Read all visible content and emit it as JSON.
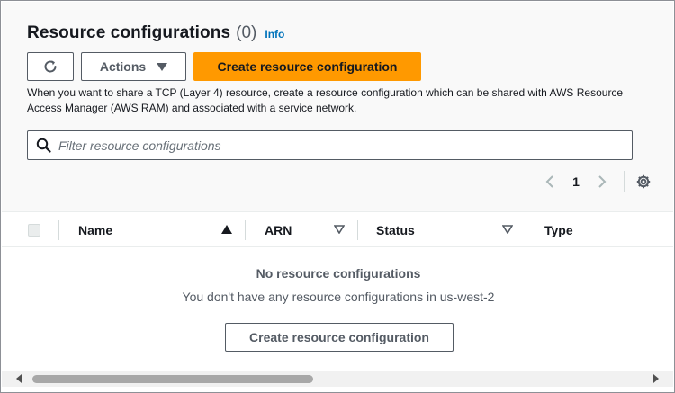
{
  "panel": {
    "title": "Resource configurations",
    "count": "(0)",
    "info_link": "Info"
  },
  "toolbar": {
    "refresh_icon": "refresh-icon",
    "actions_label": "Actions",
    "create_label": "Create resource configuration"
  },
  "description": "When you want to share a TCP (Layer 4) resource, create a resource configuration which can be shared with AWS Resource Access Manager (AWS RAM) and associated with a service network.",
  "filter": {
    "placeholder": "Filter resource configurations",
    "value": ""
  },
  "pagination": {
    "current_page": "1"
  },
  "table": {
    "columns": [
      {
        "label": "Name",
        "sort": "ascending"
      },
      {
        "label": "ARN",
        "sort": "none"
      },
      {
        "label": "Status",
        "sort": "none"
      },
      {
        "label": "Type",
        "sort": "none"
      }
    ],
    "rows": []
  },
  "empty_state": {
    "title": "No resource configurations",
    "message": "You don't have any resource configurations in us-west-2",
    "button_label": "Create resource configuration"
  },
  "colors": {
    "primary_button": "#ff9900",
    "link": "#0073bb",
    "text": "#16191f",
    "muted_text": "#545b64"
  }
}
